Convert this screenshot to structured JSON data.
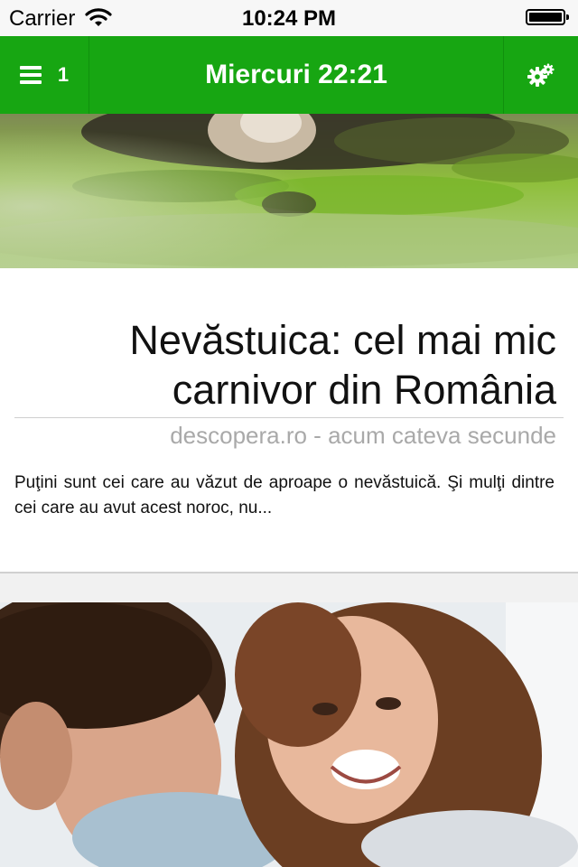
{
  "status_bar": {
    "carrier": "Carrier",
    "time": "10:24 PM"
  },
  "nav_bar": {
    "menu_count": "1",
    "title": "Miercuri 22:21"
  },
  "articles": [
    {
      "headline": "Nevăstuica: cel mai mic carnivor din România",
      "meta": "descopera.ro - acum cateva secunde",
      "excerpt": "Puţini sunt cei care au văzut de aproape o nevăstuică. Şi mulţi dintre cei care au avut acest noroc, nu..."
    }
  ],
  "colors": {
    "nav_green": "#17a612",
    "meta_gray": "#a9a9a9"
  },
  "icons": [
    "wifi-icon",
    "battery-icon",
    "hamburger-menu-icon",
    "settings-gears-icon"
  ]
}
